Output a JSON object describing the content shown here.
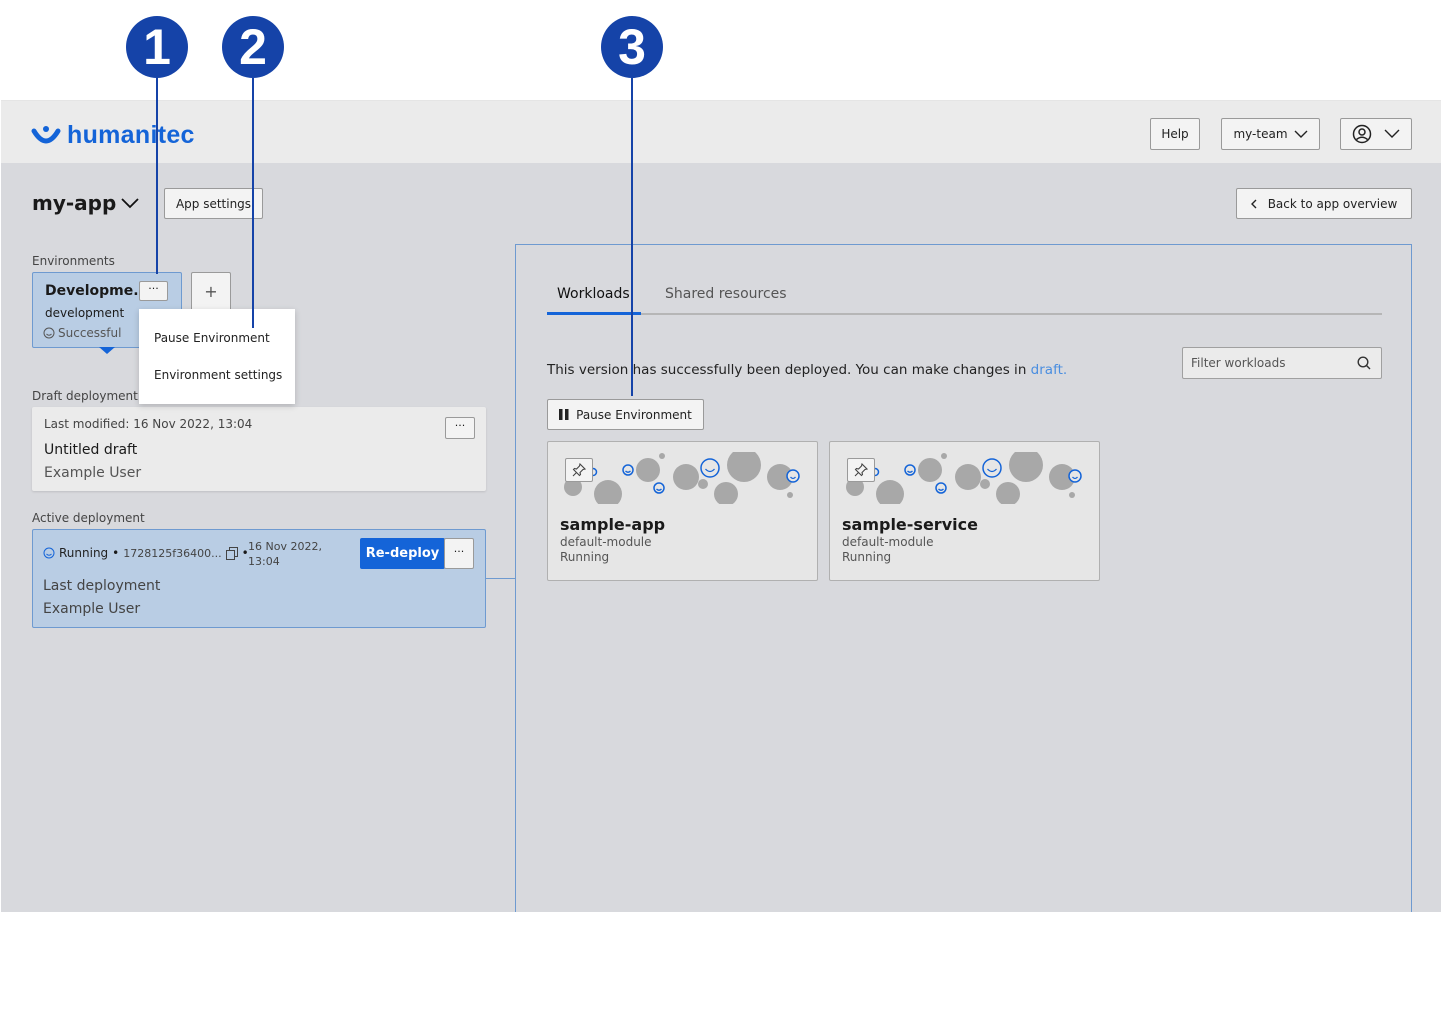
{
  "annotations": [
    "1",
    "2",
    "3"
  ],
  "header": {
    "logo_text": "humanitec",
    "help_label": "Help",
    "team_label": "my-team"
  },
  "app": {
    "name": "my-app",
    "settings_label": "App settings",
    "back_label": "Back to app overview"
  },
  "environments": {
    "section_label": "Environments",
    "selected": {
      "name": "Developme...",
      "id": "development",
      "status": "Successful"
    },
    "add_label": "+",
    "menu": [
      "Pause Environment",
      "Environment settings"
    ]
  },
  "draft": {
    "section_label": "Draft deployment",
    "modified": "Last modified: 16 Nov 2022, 13:04",
    "title": "Untitled draft",
    "user": "Example User",
    "more_label": "..."
  },
  "active": {
    "section_label": "Active deployment",
    "status": "Running",
    "hash": "1728125f36400...",
    "date_line1": "16 Nov 2022,",
    "date_line2": "13:04",
    "redeploy_label": "Re-deploy",
    "more_label": "...",
    "title": "Last deployment",
    "user": "Example User"
  },
  "main": {
    "tabs": [
      "Workloads",
      "Shared resources"
    ],
    "active_tab": "Workloads",
    "message": "This version has successfully been deployed. You can make changes in",
    "draft_link": "draft.",
    "filter_placeholder": "Filter workloads",
    "pause_label": "Pause Environment",
    "workloads": [
      {
        "name": "sample-app",
        "module": "default-module",
        "status": "Running"
      },
      {
        "name": "sample-service",
        "module": "default-module",
        "status": "Running"
      }
    ]
  },
  "colors": {
    "brand": "#1464d8",
    "annotation": "#1543a8",
    "selected_card": "#b9cde4",
    "frame_bg": "#d8d9dd"
  }
}
